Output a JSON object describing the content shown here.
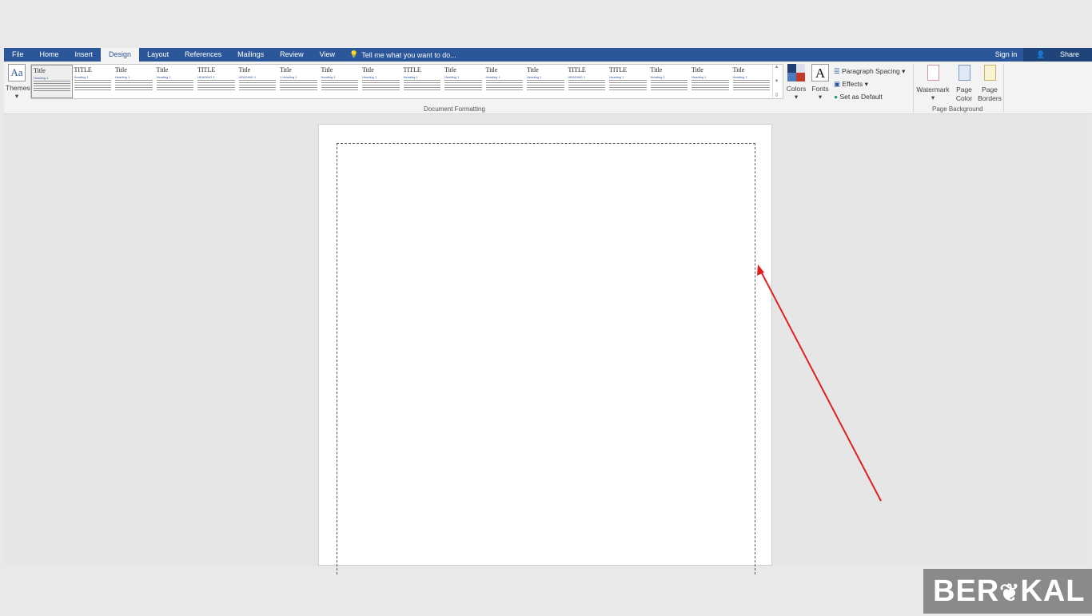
{
  "tabs": [
    "File",
    "Home",
    "Insert",
    "Design",
    "Layout",
    "References",
    "Mailings",
    "Review",
    "View"
  ],
  "active_tab": "Design",
  "tell_me": "Tell me what you want to do...",
  "sign_in": "Sign in",
  "share": "Share",
  "themes_label": "Themes",
  "gallery": [
    {
      "title": "Title",
      "heading": "Heading 1"
    },
    {
      "title": "TITLE",
      "heading": "Heading 1"
    },
    {
      "title": "Title",
      "heading": "Heading 1"
    },
    {
      "title": "Title",
      "heading": "Heading 1"
    },
    {
      "title": "TITLE",
      "heading": "HEADING 1"
    },
    {
      "title": "Title",
      "heading": "HEADING 1"
    },
    {
      "title": "Title",
      "heading": "1 Heading 1"
    },
    {
      "title": "Title",
      "heading": "Heading 1"
    },
    {
      "title": "Title",
      "heading": "Heading 1"
    },
    {
      "title": "TITLE",
      "heading": "Heading 1"
    },
    {
      "title": "Title",
      "heading": "Heading 1"
    },
    {
      "title": "Title",
      "heading": "Heading 1"
    },
    {
      "title": "Title",
      "heading": "Heading 1"
    },
    {
      "title": "TITLE",
      "heading": "HEADING 1"
    },
    {
      "title": "TITLE",
      "heading": "Heading 1"
    },
    {
      "title": "Title",
      "heading": "Heading 1"
    },
    {
      "title": "Title",
      "heading": "Heading 1"
    },
    {
      "title": "Title",
      "heading": "Heading 1"
    }
  ],
  "document_formatting": "Document Formatting",
  "colors_label": "Colors",
  "fonts_label": "Fonts",
  "fonts_glyph": "A",
  "paragraph_spacing": "Paragraph Spacing",
  "effects": "Effects",
  "set_default": "Set as Default",
  "watermark": "Watermark",
  "page_color": "Page Color",
  "page_borders": "Page Borders",
  "page_background": "Page Background",
  "logo": "BERAKAL",
  "colors": {
    "accent": "#2b579a",
    "arrow": "#e02020"
  }
}
